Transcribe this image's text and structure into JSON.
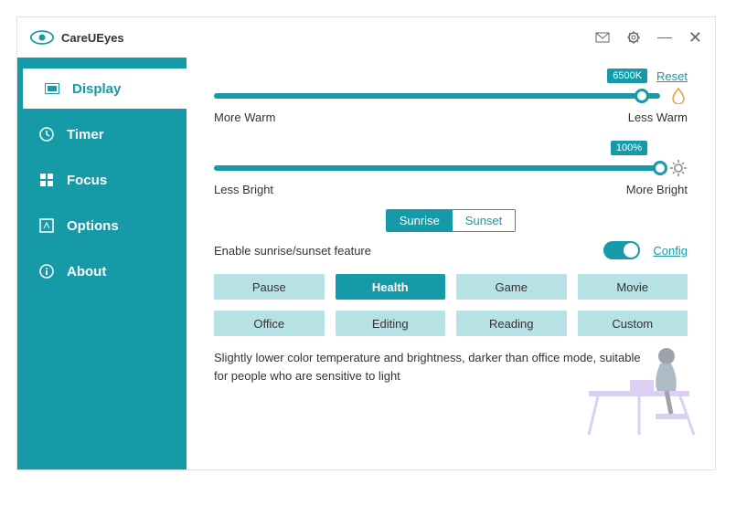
{
  "app": {
    "name": "CareUEyes"
  },
  "sidebar": {
    "items": [
      {
        "label": "Display"
      },
      {
        "label": "Timer"
      },
      {
        "label": "Focus"
      },
      {
        "label": "Options"
      },
      {
        "label": "About"
      }
    ]
  },
  "colorTemp": {
    "value": "6500K",
    "reset": "Reset",
    "leftLabel": "More Warm",
    "rightLabel": "Less Warm",
    "percent": 96
  },
  "brightness": {
    "value": "100%",
    "leftLabel": "Less Bright",
    "rightLabel": "More Bright",
    "percent": 100
  },
  "sunriseSunset": {
    "sunrise": "Sunrise",
    "sunset": "Sunset",
    "enable": "Enable sunrise/sunset feature",
    "config": "Config"
  },
  "modes": {
    "items": [
      "Pause",
      "Health",
      "Game",
      "Movie",
      "Office",
      "Editing",
      "Reading",
      "Custom"
    ],
    "active": "Health",
    "description": "Slightly lower color temperature and brightness, darker than office mode, suitable for people who are sensitive to light"
  },
  "colors": {
    "accent": "#169aa7"
  }
}
